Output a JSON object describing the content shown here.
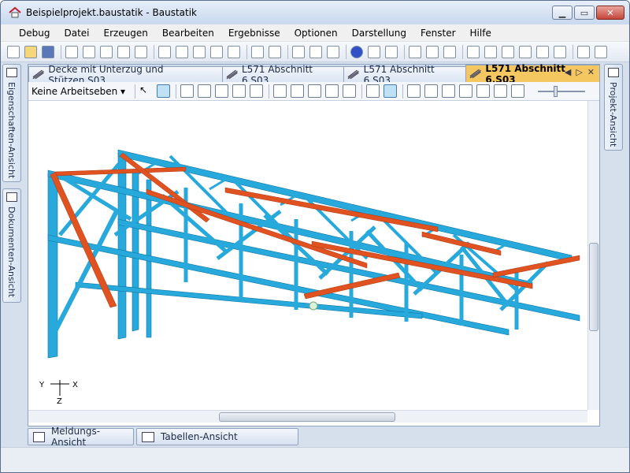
{
  "window": {
    "title": "Beispielprojekt.baustatik - Baustatik"
  },
  "menu": [
    "Debug",
    "Datei",
    "Erzeugen",
    "Bearbeiten",
    "Ergebnisse",
    "Optionen",
    "Darstellung",
    "Fenster",
    "Hilfe"
  ],
  "left_dock": {
    "properties_label": "Eigenschaften-Ansicht",
    "documents_label": "Dokumenten-Ansicht"
  },
  "right_dock": {
    "project_label": "Projekt-Ansicht"
  },
  "tabs": [
    {
      "label": "Decke mit Unterzug und Stützen.S03",
      "active": false
    },
    {
      "label": "L571 Abschnitt 6.S03",
      "active": false
    },
    {
      "label": "L571 Abschnitt 6.S03",
      "active": false
    },
    {
      "label": "L571 Abschnitt 6.S03",
      "active": true
    }
  ],
  "doc_toolbar": {
    "workplane_select": "Keine Arbeitseben"
  },
  "axes": {
    "y": "Y",
    "x": "X",
    "z": "Z"
  },
  "bottom_tabs": {
    "messages": "Meldungs-Ansicht",
    "tables": "Tabellen-Ansicht"
  },
  "colors": {
    "members": "#27a9dc",
    "members_edge": "#0f77a6",
    "highlight": "#e0521f",
    "active_tab": "#f4c760"
  }
}
